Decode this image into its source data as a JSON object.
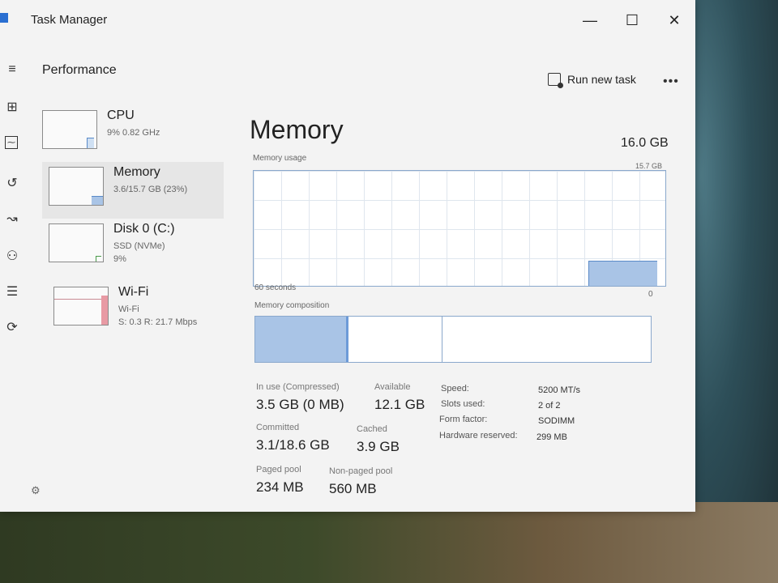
{
  "window": {
    "title": "Task Manager",
    "controls": {
      "minimize": "—",
      "maximize": "☐",
      "close": "✕"
    }
  },
  "rail": {
    "icons": [
      "hamburger-icon",
      "processes-icon",
      "performance-icon",
      "app-history-icon",
      "startup-apps-icon",
      "users-icon",
      "details-icon",
      "services-icon"
    ]
  },
  "header": {
    "section": "Performance",
    "run_new_task": "Run new task",
    "more": "•••"
  },
  "devices": [
    {
      "name": "CPU",
      "sub1": "9% 0.82 GHz",
      "sub2": ""
    },
    {
      "name": "Memory",
      "sub1": "3.6/15.7 GB (23%)",
      "sub2": ""
    },
    {
      "name": "Disk 0 (C:)",
      "sub1": "SSD (NVMe)",
      "sub2": "9%"
    },
    {
      "name": "Wi-Fi",
      "sub1": "Wi-Fi",
      "sub2": "S: 0.3 R: 21.7 Mbps"
    }
  ],
  "main": {
    "title": "Memory",
    "total": "16.0 GB",
    "usage_label": "Memory usage",
    "usage_max": "15.7 GB",
    "time_left": "60 seconds",
    "time_right": "0",
    "composition_label": "Memory composition"
  },
  "stats": {
    "in_use_label": "In use (Compressed)",
    "in_use_value": "3.5 GB (0 MB)",
    "available_label": "Available",
    "available_value": "12.1 GB",
    "committed_label": "Committed",
    "committed_value": "3.1/18.6 GB",
    "cached_label": "Cached",
    "cached_value": "3.9 GB",
    "paged_label": "Paged pool",
    "paged_value": "234 MB",
    "nonpaged_label": "Non-paged pool",
    "nonpaged_value": "560 MB"
  },
  "specs": {
    "speed_label": "Speed:",
    "speed_value": "5200 MT/s",
    "slots_label": "Slots used:",
    "slots_value": "2 of 2",
    "form_label": "Form factor:",
    "form_value": "SODIMM",
    "reserved_label": "Hardware reserved:",
    "reserved_value": "299 MB"
  },
  "colors": {
    "graph_fill": "#a9c4e6",
    "graph_border": "#8aa8cc",
    "wifi_bar": "#e89aa4"
  }
}
